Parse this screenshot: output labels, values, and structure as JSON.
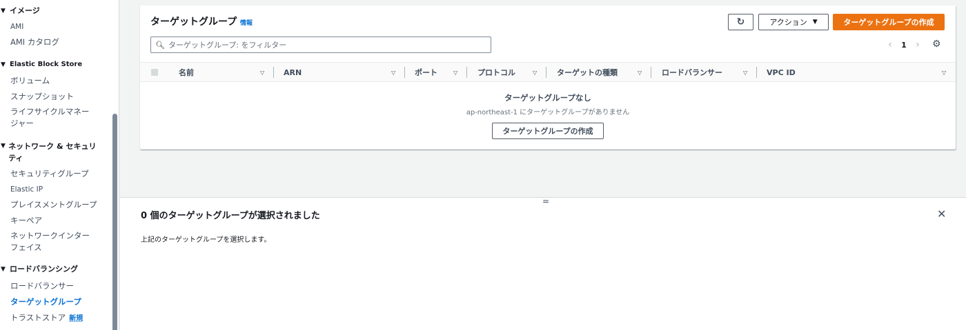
{
  "sidebar": {
    "sections": [
      {
        "title": "イメージ",
        "items": [
          "AMI",
          "AMI カタログ"
        ]
      },
      {
        "title": "Elastic Block Store",
        "items": [
          "ボリューム",
          "スナップショット",
          "ライフサイクルマネージャー"
        ]
      },
      {
        "title": "ネットワーク & セキュリティ",
        "items": [
          "セキュリティグループ",
          "Elastic IP",
          "プレイスメントグループ",
          "キーペア",
          "ネットワークインターフェイス"
        ]
      },
      {
        "title": "ロードバランシング",
        "items": [
          "ロードバランサー",
          "ターゲットグループ",
          "トラストストア"
        ]
      }
    ],
    "new_badge": "新規",
    "active_item": "ターゲットグループ"
  },
  "panel": {
    "title": "ターゲットグループ",
    "info_link": "情報",
    "refresh_icon": "refresh-icon",
    "actions_label": "アクション",
    "create_label": "ターゲットグループの作成",
    "filter_placeholder": "ターゲットグループ: をフィルター",
    "pager": {
      "current_page": "1"
    },
    "columns": [
      "名前",
      "ARN",
      "ポート",
      "プロトコル",
      "ターゲットの種類",
      "ロードバランサー",
      "VPC ID"
    ],
    "empty": {
      "title": "ターゲットグループなし",
      "subtitle": "ap-northeast-1 にターゲットグループがありません",
      "button": "ターゲットグループの作成"
    }
  },
  "split_panel": {
    "handle": "=",
    "title": "0 個のターゲットグループが選択されました",
    "description": "上記のターゲットグループを選択します。",
    "close_icon": "close-icon"
  },
  "colors": {
    "primary": "#ec7211",
    "link": "#0972d3",
    "text": "#16191f"
  }
}
